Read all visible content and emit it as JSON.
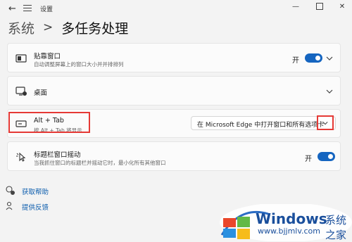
{
  "titlebar": {
    "app_title": "设置",
    "back": "←",
    "minimize": "—",
    "close": "✕"
  },
  "breadcrumb": {
    "parent": "系统",
    "separator": ">",
    "current": "多任务处理"
  },
  "cards": {
    "snap": {
      "title": "贴靠窗口",
      "desc": "自动调整屏幕上的窗口大小并并排排列",
      "toggle_label": "开",
      "toggle_on": true
    },
    "desktops": {
      "title": "桌面"
    },
    "alttab": {
      "title": "Alt + Tab",
      "desc": "按 Alt + Tab 将显示",
      "selected": "在 Microsoft Edge 中打开窗口和所有选项卡"
    },
    "shake": {
      "title": "标题栏窗口摇动",
      "desc": "当我抓住窗口的标题栏并摇动它时，最小化所有其他窗口",
      "toggle_label": "开",
      "toggle_on": true
    }
  },
  "links": {
    "help": "获取帮助",
    "feedback": "提供反馈"
  },
  "watermark": {
    "brand": "Windows",
    "brand_cn": "系统之家",
    "url": "www.bjjmlv.com"
  },
  "colors": {
    "accent": "#1565c0",
    "highlight": "#e53935",
    "link": "#0b5cad"
  }
}
